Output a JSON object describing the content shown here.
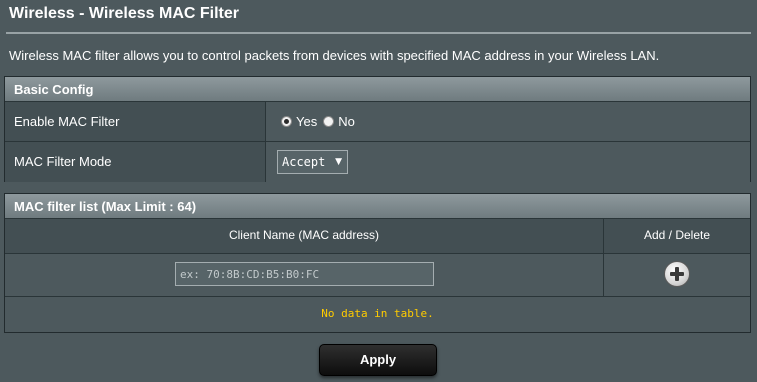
{
  "page": {
    "title": "Wireless - Wireless MAC Filter",
    "description": "Wireless MAC filter allows you to control packets from devices with specified MAC address in your Wireless LAN."
  },
  "basic_config": {
    "header": "Basic Config",
    "enable_label": "Enable MAC Filter",
    "enable_options": [
      {
        "label": "Yes",
        "selected": true
      },
      {
        "label": "No",
        "selected": false
      }
    ],
    "mode_label": "MAC Filter Mode",
    "mode_value": "Accept"
  },
  "mac_list": {
    "header": "MAC filter list (Max Limit : 64)",
    "columns": [
      "Client Name (MAC address)",
      "Add / Delete"
    ],
    "input_placeholder": "ex: 70:8B:CD:B5:B0:FC",
    "empty_message": "No data in table."
  },
  "actions": {
    "apply_label": "Apply"
  },
  "icons": {
    "add": "plus-circle-icon",
    "dropdown": "chevron-down-icon"
  },
  "colors": {
    "background": "#4d595d",
    "empty_message": "#ffcc00"
  }
}
